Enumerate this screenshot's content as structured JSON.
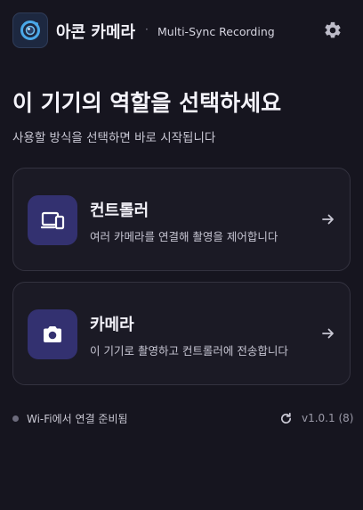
{
  "header": {
    "app_name": "아콘 카메라",
    "separator": "·",
    "subtitle": "Multi-Sync Recording",
    "icons": {
      "app": "camera-lens-icon",
      "settings": "gear-icon"
    }
  },
  "main": {
    "heading": "이 기기의 역할을 선택하세요",
    "subheading": "사용할 방식을 선택하면 바로 시작됩니다",
    "roles": [
      {
        "title": "컨트롤러",
        "description": "여러 카메라를 연결해 촬영을 제어합니다",
        "icon": "devices-icon"
      },
      {
        "title": "카메라",
        "description": "이 기기로 촬영하고 컨트롤러에 전송합니다",
        "icon": "camera-icon"
      }
    ]
  },
  "footer": {
    "status": "Wi-Fi에서 연결 준비됨",
    "version": "v1.0.1 (8)",
    "icons": {
      "refresh": "refresh-icon"
    }
  },
  "colors": {
    "background": "#16151f",
    "card_background": "#1b1a25",
    "card_border": "#33323f",
    "icon_tile": "#333170",
    "accent_blue": "#4aa8e8"
  }
}
